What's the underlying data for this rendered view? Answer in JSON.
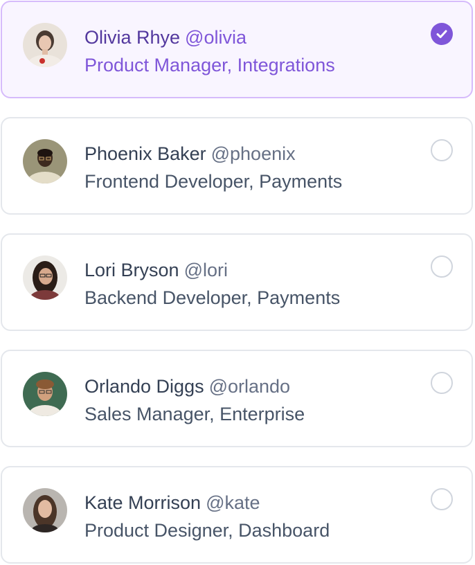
{
  "members": [
    {
      "name": "Olivia Rhye",
      "handle": "@olivia",
      "role": "Product Manager, Integrations",
      "selected": true
    },
    {
      "name": "Phoenix Baker",
      "handle": "@phoenix",
      "role": "Frontend Developer, Payments",
      "selected": false
    },
    {
      "name": "Lori Bryson",
      "handle": "@lori",
      "role": "Backend Developer, Payments",
      "selected": false
    },
    {
      "name": "Orlando Diggs",
      "handle": "@orlando",
      "role": "Sales Manager, Enterprise",
      "selected": false
    },
    {
      "name": "Kate Morrison",
      "handle": "@kate",
      "role": "Product Designer, Dashboard",
      "selected": false
    }
  ],
  "colors": {
    "accent": "#7f56d9",
    "selected_bg": "#f9f5ff",
    "selected_border": "#d6bbfb",
    "border": "#e4e7ec"
  }
}
